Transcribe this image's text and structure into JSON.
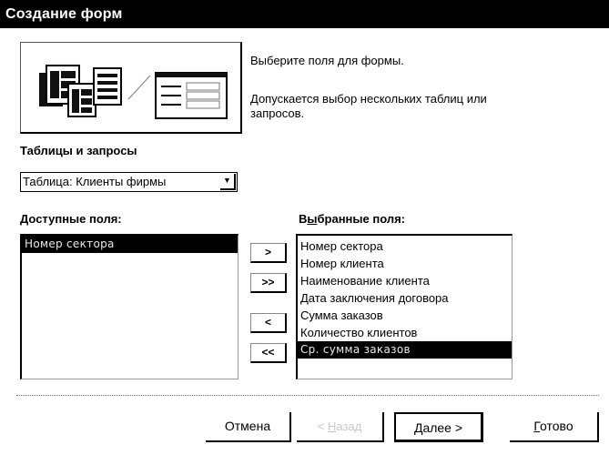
{
  "window": {
    "title": "Создание форм"
  },
  "hints": {
    "line1": "Выберите поля для формы.",
    "line2a": "Допускается выбор нескольких таблиц или",
    "line2b": "запросов."
  },
  "source": {
    "label": "Таблицы и запросы",
    "selected": "Таблица: Клиенты фирмы"
  },
  "available": {
    "label_hotkey": "Д",
    "label_rest": "оступные поля:",
    "items": [
      "Номер сектора"
    ]
  },
  "selected_fields": {
    "label_before": "В",
    "label_hotkey": "ы",
    "label_rest": "бранные поля:",
    "items": [
      "Номер сектора",
      "Номер клиента",
      "Наименование клиента",
      "Дата заключения договора",
      "Сумма заказов",
      "Количество клиентов",
      "Ср. сумма заказов"
    ]
  },
  "move_buttons": {
    "add": ">",
    "add_all": ">>",
    "remove": "<",
    "remove_all": "<<"
  },
  "footer": {
    "cancel": "Отмена",
    "back_hotkey": "Н",
    "back_rest": "азад",
    "back_prefix": "< ",
    "next_hotkey": "Д",
    "next_rest": "алее >",
    "finish_hotkey": "Г",
    "finish_rest": "отово"
  },
  "colors": {
    "titlebar": "#000000",
    "selection": "#000000",
    "disabled_text": "#c8c8c8"
  },
  "icons": {
    "wizard_picture": "table-to-form-illustration",
    "combo_arrow": "chevron-down-icon"
  }
}
